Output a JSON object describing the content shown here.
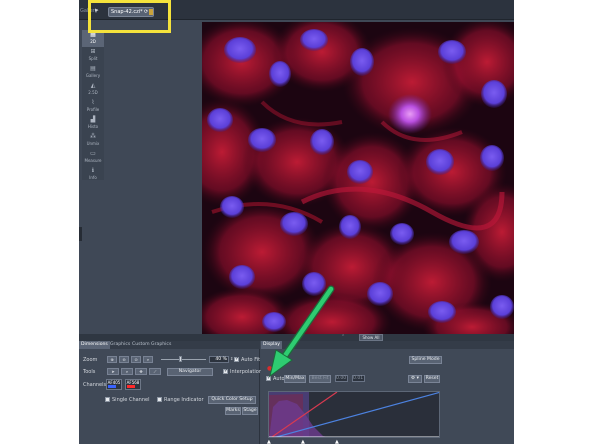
{
  "tabs": {
    "previous_label": "Gallery",
    "document_tab_label": "Snap-42.czi*",
    "pin_symbol": "⟳"
  },
  "view_rail": {
    "items": [
      {
        "label": "2D",
        "icon": "grid-icon"
      },
      {
        "label": "Split",
        "icon": "split-icon"
      },
      {
        "label": "Gallery",
        "icon": "gallery-icon"
      },
      {
        "label": "2.5D",
        "icon": "surface-icon"
      },
      {
        "label": "Profile",
        "icon": "profile-icon"
      },
      {
        "label": "Histo",
        "icon": "histogram-icon"
      },
      {
        "label": "Unmix",
        "icon": "unmix-icon"
      },
      {
        "label": "Measure",
        "icon": "measure-icon"
      },
      {
        "label": "Info",
        "icon": "info-icon"
      }
    ]
  },
  "image_bar": {
    "collapse_symbol": "⌃",
    "show_all_label": "Show All"
  },
  "dimensions_panel": {
    "tabs": [
      "Dimensions",
      "Graphics",
      "Custom Graphics"
    ],
    "zoom_label": "Zoom",
    "zoom_value": "40 %",
    "auto_fit_label": "Auto Fit",
    "tools_label": "Tools",
    "navigator_label": "Navigator",
    "interpolation_label": "Interpolation",
    "channels_label": "Channels",
    "channels": [
      {
        "name": "AF405",
        "color": "#3a63ff"
      },
      {
        "name": "AF568",
        "color": "#ff2a2a"
      }
    ],
    "single_channel_label": "Single Channel",
    "range_indicator_label": "Range Indicator",
    "quick_color_setup_label": "Quick Color Setup",
    "marks_label": "Marks",
    "stage_label": "Stage",
    "tool_buttons": [
      "⊕",
      "⊖",
      "⊙",
      "⌕"
    ]
  },
  "display_panel": {
    "tab_label": "Display",
    "spline_mode_label": "Spline Mode",
    "auto_label": "Auto",
    "minmax_label": "Min/Max",
    "best_fit_label": "Best Fit",
    "field_a": "0.00",
    "field_b": "0.01",
    "reset_label": "Reset",
    "settings_label": "⚙ ▾"
  },
  "colors": {
    "highlight": "#f5e33c",
    "annotation_arrow": "#2ecc71",
    "nucleus": "#5b3fd8",
    "cytoplasm": "#d81f3a"
  }
}
